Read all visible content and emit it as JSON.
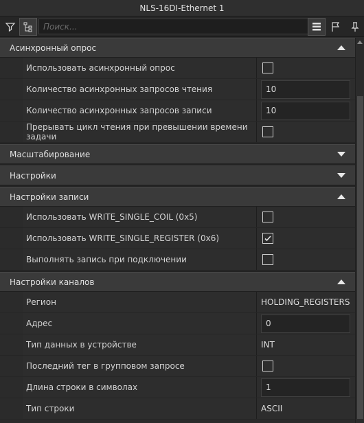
{
  "window": {
    "title": "NLS-16DI-Ethernet 1"
  },
  "toolbar": {
    "search_placeholder": "Поиск...",
    "left_icons": [
      "filter-icon",
      "tree-icon"
    ],
    "right_icons": [
      "list-icon",
      "flag-icon",
      "pin-icon"
    ]
  },
  "sections": [
    {
      "title": "Асинхронный опрос",
      "expanded": true,
      "rows": [
        {
          "label": "Использовать асинхронный опрос",
          "type": "checkbox",
          "checked": false
        },
        {
          "label": "Количество асинхронных запросов чтения",
          "type": "textbox",
          "value": "10"
        },
        {
          "label": "Количество асинхронных запросов записи",
          "type": "textbox",
          "value": "10"
        },
        {
          "label": "Прерывать цикл чтения при превышении времени задачи",
          "type": "checkbox",
          "checked": false
        }
      ]
    },
    {
      "title": "Масштабирование",
      "expanded": false,
      "rows": []
    },
    {
      "title": "Настройки",
      "expanded": false,
      "rows": []
    },
    {
      "title": "Настройки записи",
      "expanded": true,
      "rows": [
        {
          "label": "Использовать WRITE_SINGLE_COIL (0x5)",
          "type": "checkbox",
          "checked": false
        },
        {
          "label": "Использовать WRITE_SINGLE_REGISTER (0x6)",
          "type": "checkbox",
          "checked": true
        },
        {
          "label": "Выполнять запись при подключении",
          "type": "checkbox",
          "checked": false
        }
      ]
    },
    {
      "title": "Настройки каналов",
      "expanded": true,
      "rows": [
        {
          "label": "Регион",
          "type": "text",
          "value": "HOLDING_REGISTERS"
        },
        {
          "label": "Адрес",
          "type": "textbox",
          "value": "0"
        },
        {
          "label": "Тип данных в устройстве",
          "type": "text",
          "value": "INT"
        },
        {
          "label": "Последний тег в групповом запросе",
          "type": "checkbox",
          "checked": false
        },
        {
          "label": "Длина строки в символах",
          "type": "textbox",
          "value": "1"
        },
        {
          "label": "Тип строки",
          "type": "text",
          "value": "ASCII"
        }
      ]
    }
  ],
  "colors": {
    "background": "#2b2b2b",
    "header": "#3a3a3a",
    "text": "#d6d6d6"
  }
}
